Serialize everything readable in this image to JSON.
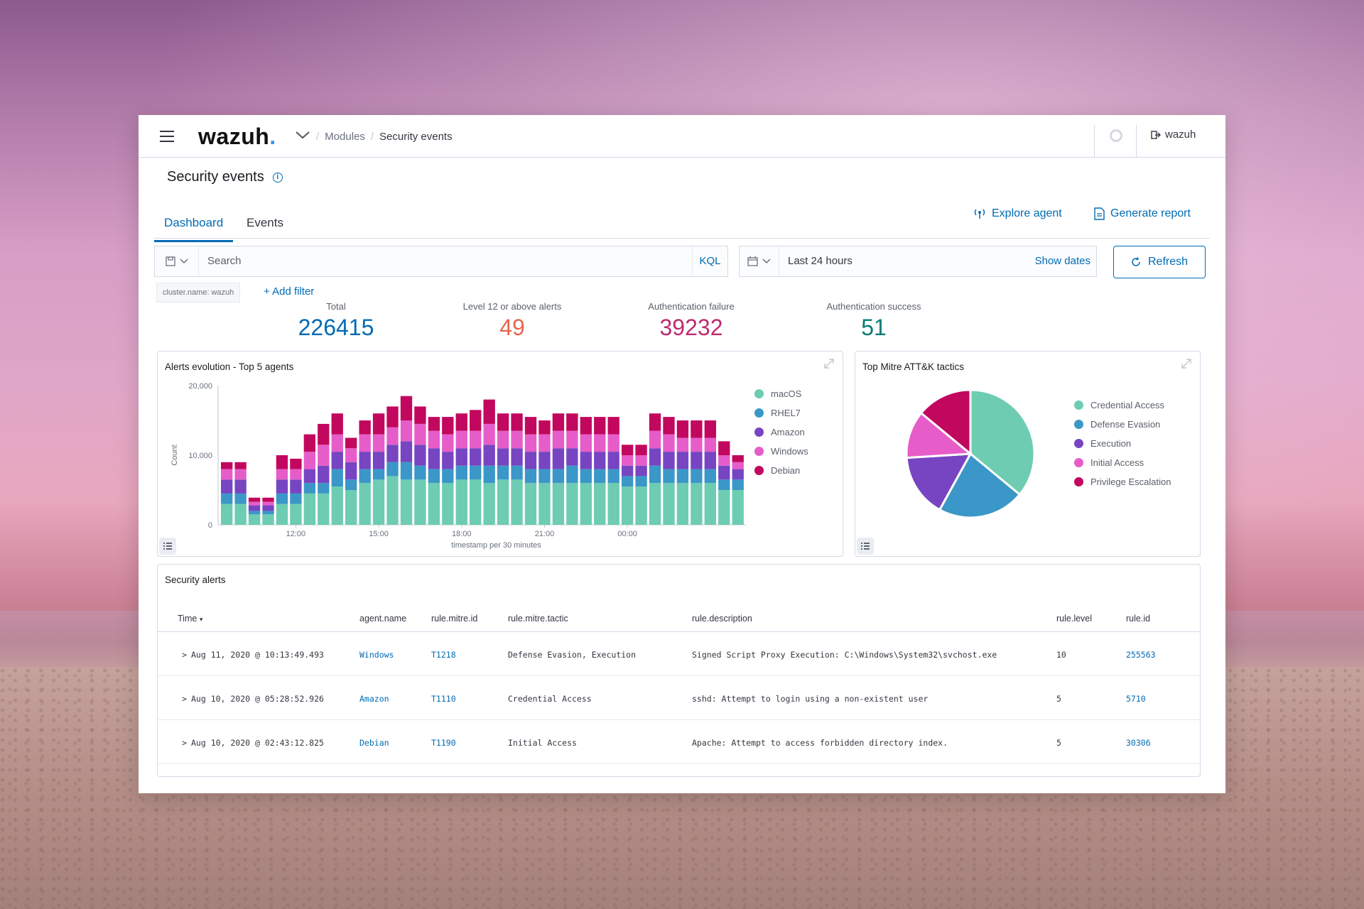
{
  "header": {
    "logo_text": "wazuh",
    "logo_dot": ".",
    "breadcrumbs": [
      "Modules",
      "Security events"
    ],
    "user": "wazuh"
  },
  "page": {
    "title": "Security events",
    "tabs": [
      {
        "label": "Dashboard",
        "active": true
      },
      {
        "label": "Events",
        "active": false
      }
    ],
    "actions": {
      "explore_agent": "Explore agent",
      "generate_report": "Generate report"
    }
  },
  "search": {
    "placeholder": "Search",
    "language": "KQL"
  },
  "date": {
    "range": "Last 24 hours",
    "show_dates": "Show dates",
    "refresh": "Refresh"
  },
  "filters": {
    "pill": "cluster.name: wazuh",
    "add": "+ Add filter"
  },
  "metrics": [
    {
      "label": "Total",
      "value": "226415",
      "color": "#006bb4"
    },
    {
      "label": "Level 12 or above alerts",
      "value": "49",
      "color": "#e7664c"
    },
    {
      "label": "Authentication failure",
      "value": "39232",
      "color": "#bd2b6f"
    },
    {
      "label": "Authentication success",
      "value": "51",
      "color": "#017d73"
    }
  ],
  "colors": {
    "macOS": "#6dccb1",
    "RHEL7": "#3b97c7",
    "Amazon": "#7745c2",
    "Windows": "#e65dc9",
    "Debian": "#c2075e",
    "accent": "#006bb4"
  },
  "panels": {
    "alerts_title": "Alerts evolution - Top 5 agents",
    "mitre_title": "Top Mitre ATT&K tactics",
    "security_alerts_title": "Security alerts"
  },
  "chart_data": [
    {
      "type": "bar",
      "stacked": true,
      "title": "Alerts evolution - Top 5 agents",
      "xlabel": "timestamp per 30 minutes",
      "ylabel": "Count",
      "ylim": [
        0,
        20000
      ],
      "yticks": [
        "20,000",
        "10,000",
        "0"
      ],
      "xticks": [
        "12:00",
        "15:00",
        "18:00",
        "21:00",
        "00:00"
      ],
      "legend_position": "right",
      "series": [
        {
          "name": "macOS",
          "values": [
            3000,
            3000,
            1500,
            1500,
            3000,
            3000,
            4500,
            4500,
            5500,
            5000,
            6000,
            6500,
            7000,
            6500,
            6500,
            6000,
            6000,
            6500,
            6500,
            6000,
            6500,
            6500,
            6000,
            6000,
            6000,
            6000,
            6000,
            6000,
            6000,
            5500,
            5500,
            6000,
            6000,
            6000,
            6000,
            6000,
            5000,
            5000
          ]
        },
        {
          "name": "RHEL7",
          "values": [
            1500,
            1500,
            500,
            500,
            1500,
            1500,
            1500,
            1500,
            2500,
            1500,
            2000,
            1500,
            2000,
            2500,
            2000,
            2000,
            2000,
            2000,
            2000,
            2500,
            2000,
            2000,
            2000,
            2000,
            2000,
            2500,
            2000,
            2000,
            2000,
            1500,
            1500,
            2500,
            2000,
            2000,
            2000,
            2000,
            1500,
            1500
          ]
        },
        {
          "name": "Amazon",
          "values": [
            2000,
            2000,
            800,
            800,
            2000,
            2000,
            2000,
            2500,
            2500,
            2500,
            2500,
            2500,
            2500,
            3000,
            3000,
            3000,
            2500,
            2500,
            2500,
            3000,
            2500,
            2500,
            2500,
            2500,
            3000,
            2500,
            2500,
            2500,
            2500,
            1500,
            1500,
            2500,
            2500,
            2500,
            2500,
            2500,
            2000,
            1500
          ]
        },
        {
          "name": "Windows",
          "values": [
            1500,
            1500,
            500,
            500,
            1500,
            1500,
            2500,
            3000,
            2500,
            2000,
            2500,
            2500,
            2500,
            3000,
            3000,
            2500,
            2500,
            2500,
            2500,
            3000,
            2500,
            2500,
            2500,
            2500,
            2500,
            2500,
            2500,
            2500,
            2500,
            1500,
            1500,
            2500,
            2500,
            2000,
            2000,
            2000,
            1500,
            1000
          ]
        },
        {
          "name": "Debian",
          "values": [
            1000,
            1000,
            600,
            600,
            2000,
            1500,
            2500,
            3000,
            3000,
            1500,
            2000,
            3000,
            3000,
            3500,
            2500,
            2000,
            2500,
            2500,
            3000,
            3500,
            2500,
            2500,
            2500,
            2000,
            2500,
            2500,
            2500,
            2500,
            2500,
            1500,
            1500,
            2500,
            2500,
            2500,
            2500,
            2500,
            2000,
            1000
          ]
        }
      ]
    },
    {
      "type": "pie",
      "title": "Top Mitre ATT&K tactics",
      "legend_position": "right",
      "labels": [
        "Credential Access",
        "Defense Evasion",
        "Execution",
        "Initial Access",
        "Privilege Escalation"
      ],
      "values": [
        36,
        22,
        16,
        12,
        14
      ],
      "colors": [
        "#6dccb1",
        "#3b97c7",
        "#7745c2",
        "#e65dc9",
        "#c2075e"
      ]
    }
  ],
  "table": {
    "columns": [
      "Time",
      "agent.name",
      "rule.mitre.id",
      "rule.mitre.tactic",
      "rule.description",
      "rule.level",
      "rule.id"
    ],
    "rows": [
      {
        "time": "Aug 11, 2020 @ 10:13:49.493",
        "agent": "Windows",
        "mitre_id": "T1218",
        "tactic": "Defense Evasion, Execution",
        "description": "Signed Script Proxy Execution: C:\\Windows\\System32\\svchost.exe",
        "level": "10",
        "rule_id": "255563"
      },
      {
        "time": "Aug 10, 2020 @ 05:28:52.926",
        "agent": "Amazon",
        "mitre_id": "T1110",
        "tactic": "Credential Access",
        "description": "sshd: Attempt to login using a non-existent user",
        "level": "5",
        "rule_id": "5710"
      },
      {
        "time": "Aug 10, 2020 @ 02:43:12.825",
        "agent": "Debian",
        "mitre_id": "T1190",
        "tactic": "Initial Access",
        "description": "Apache: Attempt to access forbidden directory index.",
        "level": "5",
        "rule_id": "30306"
      }
    ]
  }
}
